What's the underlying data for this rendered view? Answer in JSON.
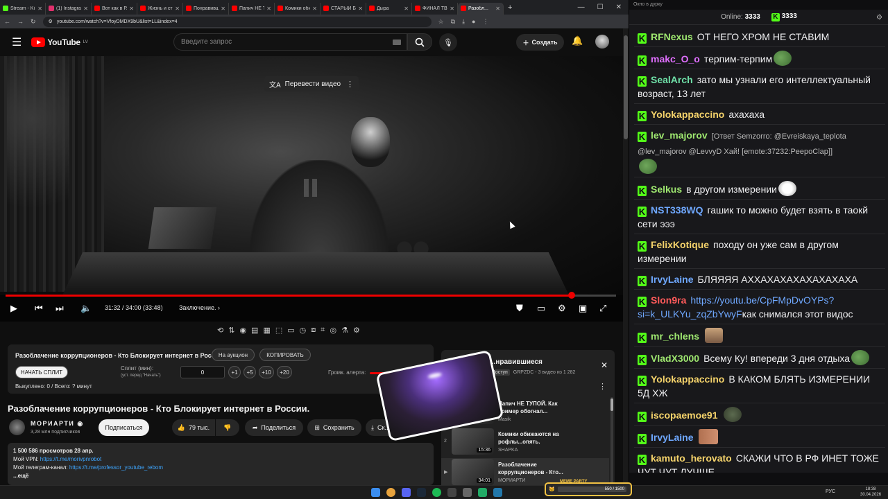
{
  "tabs": [
    {
      "label": "Stream - Ki",
      "color": "#53fc18"
    },
    {
      "label": "(1) Instagram",
      "color": "#e1306c"
    },
    {
      "label": "Вот как в Р...",
      "color": "#ff0000"
    },
    {
      "label": "Жизнь и стр...",
      "color": "#ff0000"
    },
    {
      "label": "Понравившо...",
      "color": "#ff0000"
    },
    {
      "label": "Папич НЕ ТУ...",
      "color": "#ff0000"
    },
    {
      "label": "Комики обих...",
      "color": "#ff0000"
    },
    {
      "label": "СТАРЫЙ БО...",
      "color": "#ff0000"
    },
    {
      "label": "Дыра",
      "color": "#ff0000"
    },
    {
      "label": "ФИНАЛ ТВИ...",
      "color": "#ff0000"
    },
    {
      "label": "Разобл...",
      "color": "#ff0000"
    }
  ],
  "address": {
    "url": "youtube.com/watch?v=VfoyDMDX9bU&list=LL&index=4"
  },
  "yt": {
    "logo": "YouTube",
    "region": "LV",
    "search_placeholder": "Введите запрос",
    "create": "Создать"
  },
  "player": {
    "translate": "Перевести видео",
    "time": "31:32 / 34:00 (33:48)",
    "chapter": "Заключение.",
    "progress": 0.927
  },
  "infobox": {
    "title": "Разоблачение коррупционеров - Кто Блокирует интернет в России.",
    "auction": "На аукцион",
    "copy": "КОПИРОВАТЬ",
    "start_split": "НАЧАТЬ СПЛИТ",
    "split_label": "Сплит (мин):",
    "split_hint": "(уст. перед \"Начать\")",
    "split_value": "0",
    "increments": [
      "+1",
      "+5",
      "+10",
      "+20"
    ],
    "alert_label": "Громк. алерта:",
    "bought": "Выкуплено: 0 / Всего: ? минут"
  },
  "video": {
    "title": "Разоблачение коррупционеров - Кто Блокирует интернет в России.",
    "channel": "МОРИАРТИ",
    "subs": "3,28 млн подписчиков",
    "subscribe": "Подписаться",
    "likes": "79 тыс.",
    "share": "Поделиться",
    "save": "Сохранить",
    "download": "Ск..."
  },
  "description": {
    "stats": "1 500 586 просмотров  28 апр.",
    "vpn_label": "Мой VPN: ",
    "vpn_link": "https://t.me/morivpnrobot",
    "tg_label": "Мой телеграм-канал: ",
    "tg_link": "https://t.me/professor_youtube_rebom",
    "more": "...ещё"
  },
  "playlist": {
    "title": "...нравившиеся",
    "access": "Доступ",
    "meta": "GRPZDC - 3 видео из 1 282",
    "items": [
      {
        "idx": "",
        "title": "Папич НЕ ТУПОЙ. Как пример обогнал...",
        "channel": "Masik",
        "dur": ""
      },
      {
        "idx": "2",
        "title": "Комики обижаются на рофлы...опять.",
        "channel": "SHAPKA",
        "dur": "15:36"
      },
      {
        "idx": "▶",
        "title": "Разоблачение коррупционеров - Кто...",
        "channel": "МОРИАРТИ",
        "dur": "34:01"
      }
    ]
  },
  "chat": {
    "header": "Окно в дурку",
    "online_label": "Online:",
    "online": "3333",
    "count": "3333",
    "messages": [
      {
        "user": "RFNexus",
        "color": "#9fe870",
        "text": "ОТ НЕГО ХРОМ НЕ СТАВИМ"
      },
      {
        "user": "makc_O_o",
        "color": "#e06fff",
        "text": "терпим-терпим",
        "emote": "em-frog"
      },
      {
        "user": "SealArch",
        "color": "#6fe0a8",
        "text": "зато мы узнали его интеллектуальный возраст, 13 лет"
      },
      {
        "user": "Yolokappaccino",
        "color": "#f5d36b",
        "text": "ахахаха"
      },
      {
        "user": "lev_majorov",
        "color": "#9fe870",
        "reply": "[Ответ Semzorro: @Evreiskaya_teplota @lev_majorov @LevvyD Хай! [emote:37232:PeepoClap]]",
        "emote": "em-frog"
      },
      {
        "user": "Selkus",
        "color": "#9fe870",
        "text": "в другом измерении",
        "emote": "em-ghost"
      },
      {
        "user": "NST338WQ",
        "color": "#6fa8ff",
        "text": "гашик то можно будет взять в таокй сети эээ"
      },
      {
        "user": "FelixKotique",
        "color": "#f5d36b",
        "text": "походу он уже сам в другом измерении"
      },
      {
        "user": "IrvyLaine",
        "color": "#6fa8ff",
        "text": "БЛЯЯЯЯ АХХАХАХАХАХАХАХАХА"
      },
      {
        "user": "Slon9ra",
        "color": "#ff5a5a",
        "link": "https://youtu.be/CpFMpDvOYPs?si=k_ULKYu_zqZbYwyF",
        "text": "как снимался этот видос"
      },
      {
        "user": "mr_chlens",
        "color": "#9fe870",
        "text": "",
        "emote": "em-face"
      },
      {
        "user": "VladX3000",
        "color": "#9fe870",
        "text": "Всему Ку! впереди 3 дня отдыха",
        "emote": "em-frog"
      },
      {
        "user": "Yolokappaccino",
        "color": "#f5d36b",
        "text": "В КАКОМ БЛЯТЬ ИЗМЕРЕНИИ 5Д ХЖ"
      },
      {
        "user": "iscopaemoe91",
        "color": "#f5d36b",
        "text": "",
        "emote": "em-turtle"
      },
      {
        "user": "IrvyLaine",
        "color": "#6fa8ff",
        "text": "",
        "emote": "em-faces"
      },
      {
        "user": "kamuto_herovato",
        "color": "#f5d36b",
        "text": "СКАЖИ ЧТО В РФ ИНЕТ ТОЖЕ ЧУТ ЧУТ ЛУЧШЕ"
      }
    ]
  },
  "taskbar": {
    "lang": "РУС",
    "time": "18:38",
    "date": "30.04.2026"
  },
  "meme": {
    "title": "MEME PARTY",
    "progress": "550 / 1500"
  }
}
